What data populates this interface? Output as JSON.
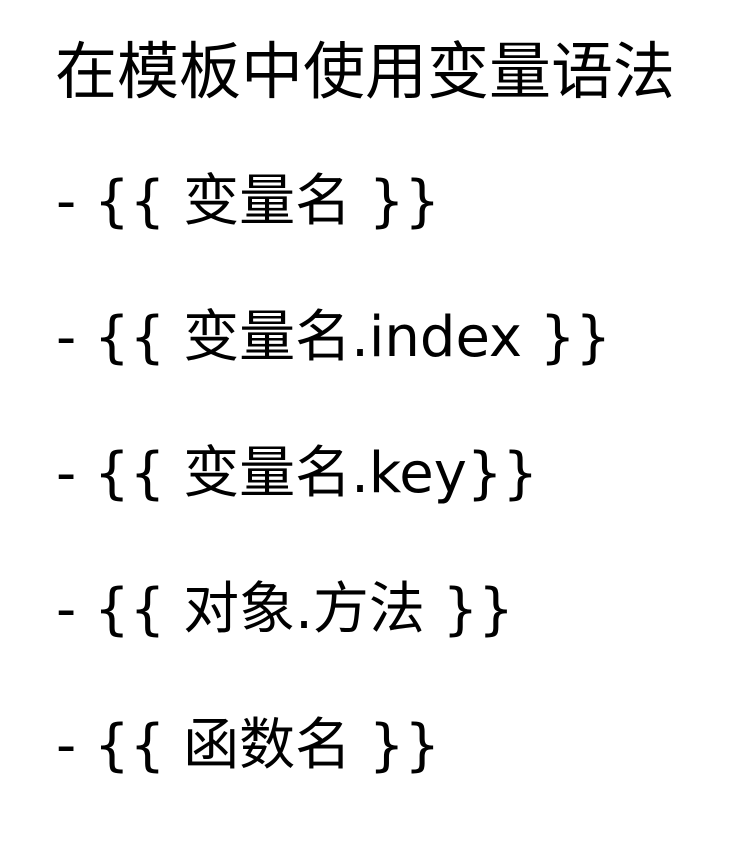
{
  "document": {
    "title": "在模板中使用变量语法",
    "items": [
      "- {{ 变量名 }}",
      "- {{ 变量名.index }}",
      "- {{ 变量名.key}}",
      "- {{ 对象.方法 }}",
      "- {{ 函数名 }}"
    ]
  }
}
